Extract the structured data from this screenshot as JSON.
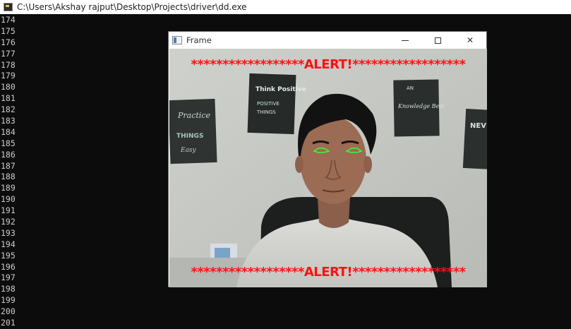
{
  "console": {
    "title": "C:\\Users\\Akshay rajput\\Desktop\\Projects\\driver\\dd.exe",
    "lines": [
      "174",
      "175",
      "176",
      "177",
      "178",
      "179",
      "180",
      "181",
      "182",
      "183",
      "184",
      "185",
      "186",
      "187",
      "188",
      "189",
      "190",
      "191",
      "192",
      "193",
      "194",
      "195",
      "196",
      "197",
      "198",
      "199",
      "200",
      "201"
    ]
  },
  "frame": {
    "title": "Frame",
    "alert_text": "******************ALERT!******************"
  },
  "posters": [
    {
      "text": "Think Positive"
    },
    {
      "text": "Practice"
    },
    {
      "text": "Knowledge Best"
    },
    {
      "text": "NEV"
    }
  ],
  "colors": {
    "alert": "#ff1010",
    "eye_contour": "#33ff33",
    "console_bg": "#0c0c0c",
    "console_text": "#cccccc"
  }
}
